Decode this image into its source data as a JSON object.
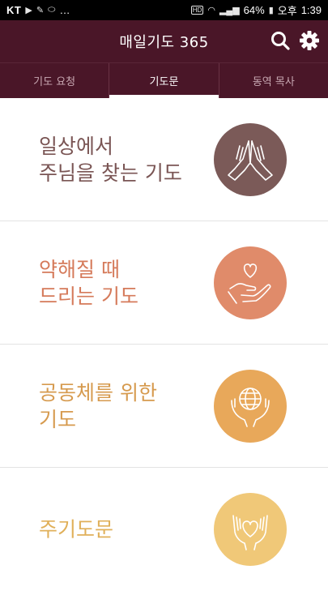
{
  "status_bar": {
    "carrier": "KT",
    "ellipsis": "…",
    "battery": "64%",
    "ampm": "오후",
    "time": "1:39"
  },
  "app_bar": {
    "title": "매일기도 365"
  },
  "tabs": [
    {
      "label": "기도 요청",
      "active": false
    },
    {
      "label": "기도문",
      "active": true
    },
    {
      "label": "동역 목사",
      "active": false
    }
  ],
  "categories": [
    {
      "label": "일상에서\n주님을 찾는 기도",
      "icon": "praying-hands-icon",
      "color": "#7b5a58"
    },
    {
      "label": "약해질 때\n드리는 기도",
      "icon": "hand-heart-icon",
      "color": "#e08b6a"
    },
    {
      "label": "공동체를 위한\n기도",
      "icon": "globe-in-hands-icon",
      "color": "#e8a85a"
    },
    {
      "label": "주기도문",
      "icon": "heart-in-hands-icon",
      "color": "#f0c878"
    }
  ],
  "colors": {
    "app_bar": "#4a1628",
    "label_1": "#7a5554",
    "label_2": "#d57a5a",
    "label_3": "#d69a4e",
    "label_4": "#e0b05a"
  }
}
